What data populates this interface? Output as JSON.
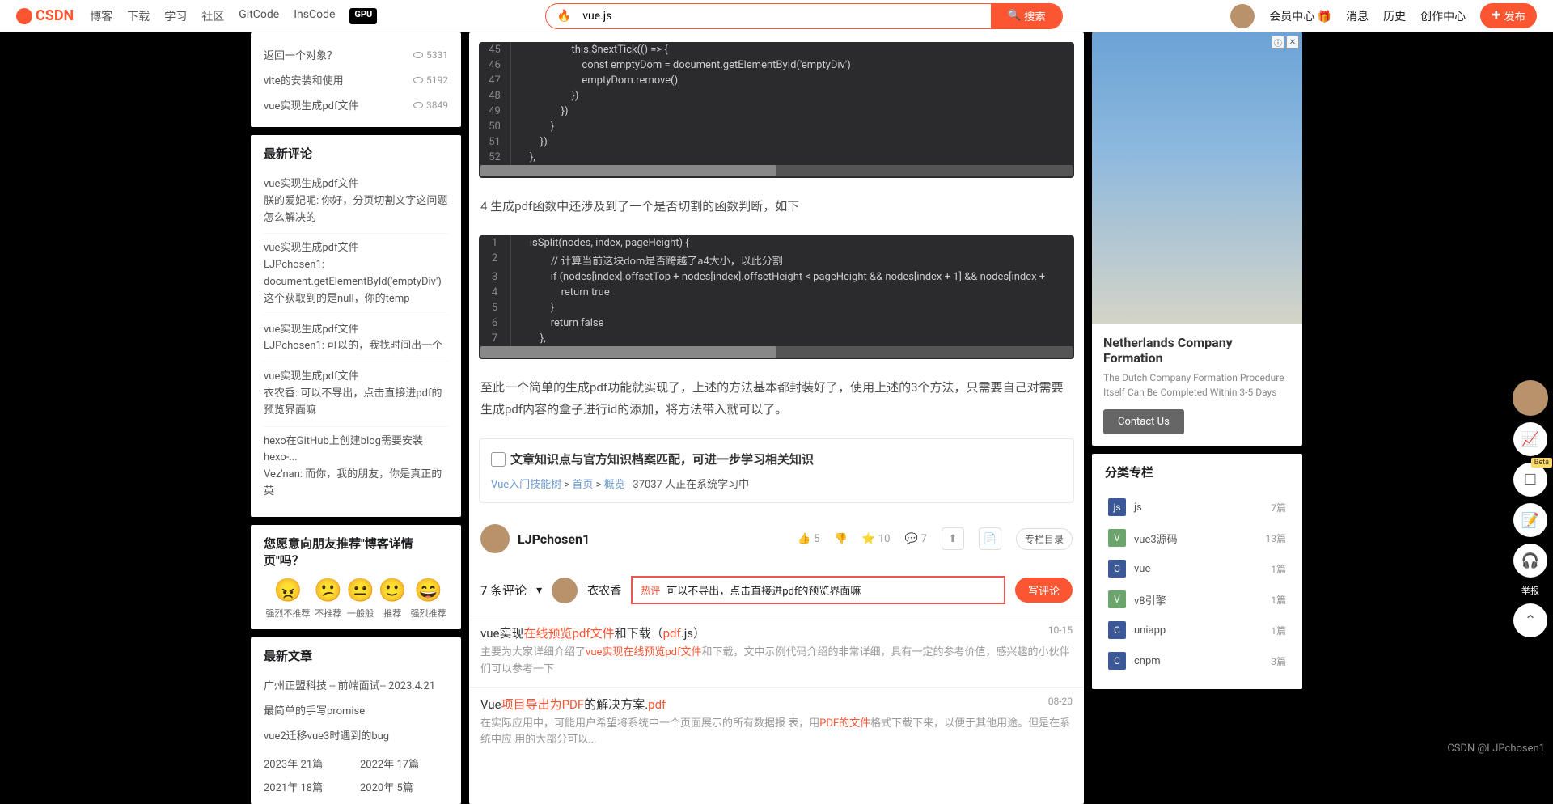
{
  "topbar": {
    "logo": "CSDN",
    "nav": [
      "博客",
      "下载",
      "学习",
      "社区",
      "GitCode",
      "InsCode"
    ],
    "gpu": "GPU",
    "search_value": "vue.js",
    "search_btn": "搜索",
    "user_links": [
      "会员中心 🎁",
      "消息",
      "历史",
      "创作中心"
    ],
    "publish": "发布"
  },
  "left": {
    "recent_posts": [
      {
        "title": "返回一个对象？",
        "views": "5331"
      },
      {
        "title": "vite的安装和使用",
        "views": "5192"
      },
      {
        "title": "vue实现生成pdf文件",
        "views": "3849"
      }
    ],
    "recent_comments_title": "最新评论",
    "recent_comments": [
      {
        "post": "vue实现生成pdf文件",
        "text": "朕的爱妃呢: 你好，分页切割文字这问题怎么解决的"
      },
      {
        "post": "vue实现生成pdf文件",
        "text": "LJPchosen1: document.getElementById('emptyDiv')这个获取到的是null，你的temp"
      },
      {
        "post": "vue实现生成pdf文件",
        "text": "LJPchosen1: 可以的，我找时间出一个"
      },
      {
        "post": "vue实现生成pdf文件",
        "text": "衣农香: 可以不导出，点击直接进pdf的预览界面嘛"
      },
      {
        "post": "hexo在GitHub上创建blog需要安装hexo-...",
        "text": "Vez'nan: 而你，我的朋友，你是真正的英"
      }
    ],
    "recommend_title": "您愿意向朋友推荐\"博客详情页\"吗？",
    "emojis": [
      {
        "face": "😠",
        "label": "强烈不推荐"
      },
      {
        "face": "😕",
        "label": "不推荐"
      },
      {
        "face": "😐",
        "label": "一般般"
      },
      {
        "face": "🙂",
        "label": "推荐"
      },
      {
        "face": "😄",
        "label": "强烈推荐"
      }
    ],
    "latest_title": "最新文章",
    "latest": [
      "广州正盟科技 -- 前端面试-- 2023.4.21",
      "最简单的手写promise",
      "vue2迁移vue3时遇到的bug"
    ],
    "years": [
      {
        "y": "2023年",
        "c": "21篇"
      },
      {
        "y": "2022年",
        "c": "17篇"
      },
      {
        "y": "2021年",
        "c": "18篇"
      },
      {
        "y": "2020年",
        "c": "5篇"
      }
    ]
  },
  "main": {
    "code1_start": 45,
    "code1": [
      "                    this.$nextTick(() => {",
      "                        const emptyDom = document.getElementById('emptyDiv')",
      "                        emptyDom.remove()",
      "                    })",
      "                })",
      "            }",
      "        })",
      "    },"
    ],
    "para1": "4 生成pdf函数中还涉及到了一个是否切割的函数判断，如下",
    "code2_start": 1,
    "code2": [
      "    isSplit(nodes, index, pageHeight) {",
      "            // 计算当前这块dom是否跨越了a4大小，以此分割",
      "            if (nodes[index].offsetTop + nodes[index].offsetHeight < pageHeight && nodes[index + 1] && nodes[index + ",
      "                return true",
      "            }",
      "            return false",
      "        },"
    ],
    "para2": "至此一个简单的生成pdf功能就实现了，上述的方法基本都封装好了，使用上述的3个方法，只需要自己对需要生成pdf内容的盒子进行id的添加，将方法带入就可以了。",
    "knowledge_title": "文章知识点与官方知识档案匹配，可进一步学习相关知识",
    "breadcrumb": {
      "root": "Vue入门技能树",
      "l1": "首页",
      "l2": "概览",
      "count": "37037 人正在系统学习中"
    },
    "author": "LJPchosen1",
    "stats": {
      "like": "5",
      "star": "10",
      "comment": "7"
    },
    "column_btn": "专栏目录",
    "comment_count": "7 条评论",
    "commenter": "衣农香",
    "hot": "热评",
    "comment_text": "可以不导出，点击直接进pdf的预览界面嘛",
    "write_comment": "写评论",
    "related": [
      {
        "title_pre": "vue实现",
        "title_orange": "在线预览pdf文件",
        "title_post": "和下载（",
        "title_orange2": "pdf",
        "title_end": ".js）",
        "date": "10-15",
        "desc_pre": "主要为大家详细介绍了",
        "desc_orange": "vue实现在线预览pdf文件",
        "desc_post": "和下载，文中示例代码介绍的非常详细，具有一定的参考价值，感兴趣的小伙伴们可以参考一下"
      },
      {
        "title_pre": "Vue",
        "title_orange": "项目导出为PDF",
        "title_post": "的解决方案.",
        "title_orange2": "pdf",
        "title_end": "",
        "date": "08-20",
        "desc_pre": "在实际应用中，可能用户希望将系统中一个页面展示的所有数据报 表，用",
        "desc_orange": "PDF的文件",
        "desc_post": "格式下载下来，以便于其他用途。但是在系统中应 用的大部分可以..."
      }
    ]
  },
  "right": {
    "ad_title": "Netherlands Company Formation",
    "ad_desc": "The Dutch Company Formation Procedure Itself Can Be Completed Within 3-5 Days",
    "ad_btn": "Contact Us",
    "category_title": "分类专栏",
    "categories": [
      {
        "icon": "js",
        "name": "js",
        "count": "7篇",
        "bg": "#3b5998"
      },
      {
        "icon": "V",
        "name": "vue3源码",
        "count": "13篇",
        "bg": "#6ba56b"
      },
      {
        "icon": "C",
        "name": "vue",
        "count": "1篇",
        "bg": "#3b5998"
      },
      {
        "icon": "V",
        "name": "v8引擎",
        "count": "1篇",
        "bg": "#6ba56b"
      },
      {
        "icon": "C",
        "name": "uniapp",
        "count": "1篇",
        "bg": "#3b5998"
      },
      {
        "icon": "C",
        "name": "cnpm",
        "count": "3篇",
        "bg": "#3b5998"
      }
    ]
  },
  "float": {
    "report": "举报"
  },
  "watermark": "CSDN @LJPchosen1"
}
